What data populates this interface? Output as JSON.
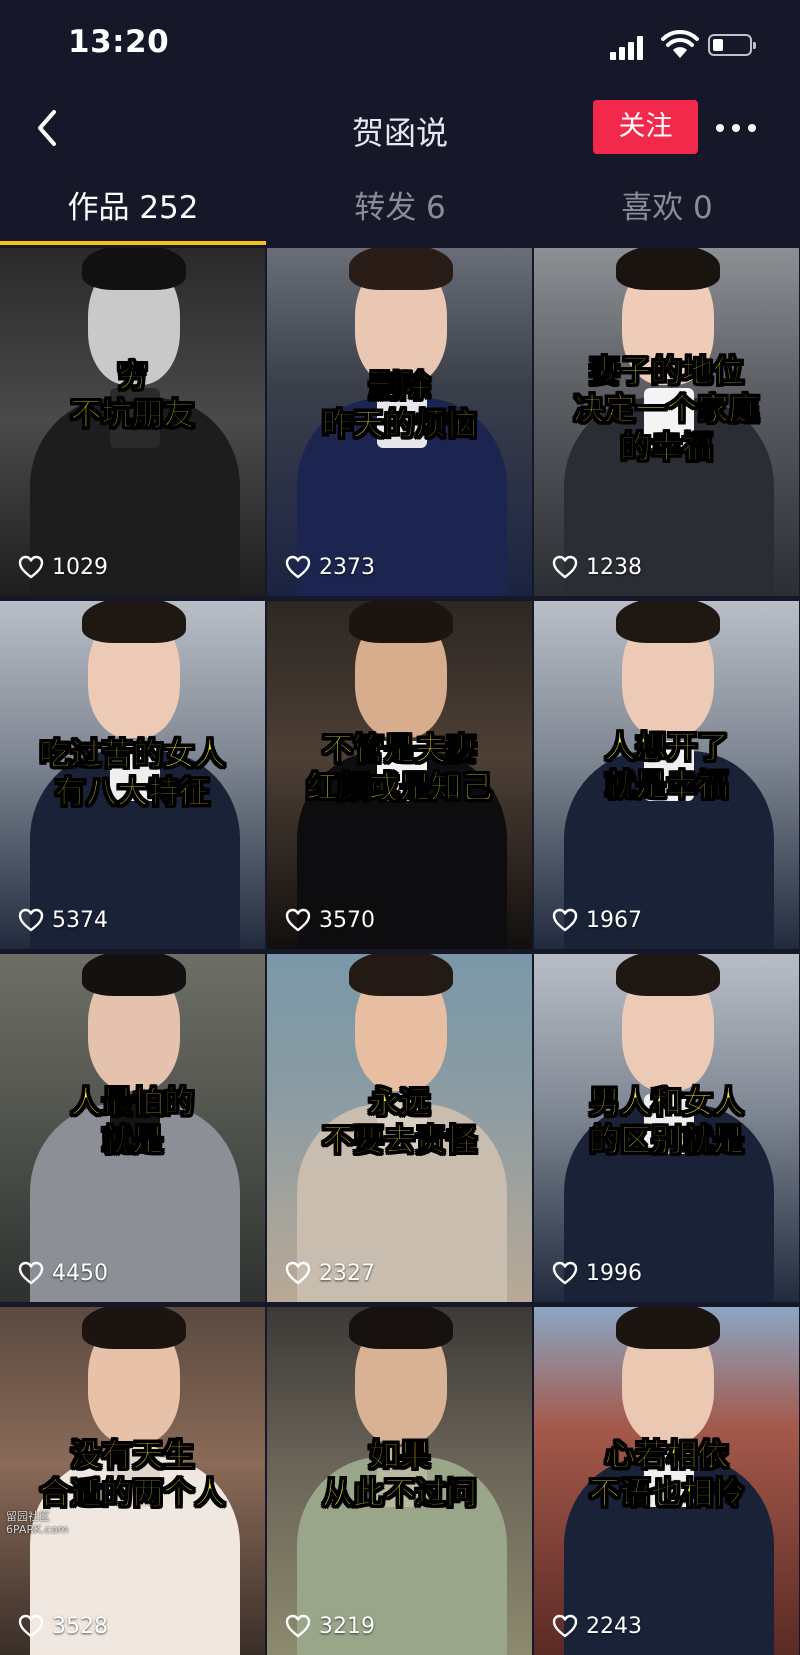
{
  "status_bar": {
    "time": "13:20"
  },
  "nav": {
    "title": "贺函说",
    "follow_label": "关注"
  },
  "tabs": [
    {
      "label": "作品 252",
      "active": true
    },
    {
      "label": "转发 6",
      "active": false
    },
    {
      "label": "喜欢 0",
      "active": false
    }
  ],
  "videos": [
    {
      "caption": [
        "穷",
        "不坑朋友"
      ],
      "likes": "1029"
    },
    {
      "caption": [
        "删除",
        "昨天的烦恼"
      ],
      "likes": "2373"
    },
    {
      "caption": [
        "妻子的地位",
        "决定一个家庭",
        "的幸福"
      ],
      "likes": "1238"
    },
    {
      "caption": [
        "吃过苦的女人",
        "有八大特征"
      ],
      "likes": "5374"
    },
    {
      "caption": [
        "不管是夫妻",
        "红颜或是知己"
      ],
      "likes": "3570"
    },
    {
      "caption": [
        "人想开了",
        "就是幸福"
      ],
      "likes": "1967"
    },
    {
      "caption": [
        "人最怕的",
        "就是"
      ],
      "likes": "4450"
    },
    {
      "caption": [
        "永远",
        "不要去责怪"
      ],
      "likes": "2327"
    },
    {
      "caption": [
        "男人和女人",
        "的区别就是"
      ],
      "likes": "1996"
    },
    {
      "caption": [
        "没有天生",
        "合适的两个人"
      ],
      "likes": "3528"
    },
    {
      "caption": [
        "如果",
        "从此不过问"
      ],
      "likes": "3219"
    },
    {
      "caption": [
        "心若相依",
        "不语也相怜"
      ],
      "likes": "2243"
    }
  ],
  "watermark": [
    "留园社区",
    "6PARK.com"
  ],
  "colors": {
    "background": "#16182a",
    "follow_button": "#f2294b",
    "tab_indicator": "#f7c21a",
    "caption": "#f8ee2e"
  },
  "icons": [
    "back-chevron-icon",
    "more-dots-icon",
    "heart-outline-icon",
    "signal-icon",
    "wifi-icon",
    "battery-icon"
  ]
}
